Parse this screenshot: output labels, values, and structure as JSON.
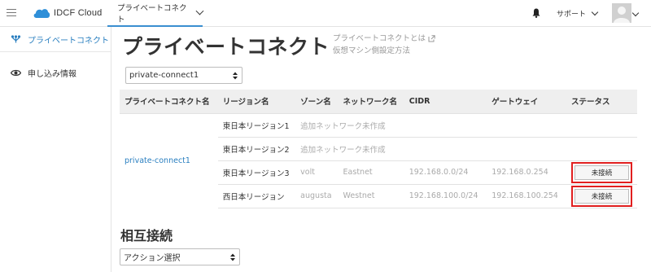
{
  "topbar": {
    "brand": "IDCF Cloud",
    "product": "プライベートコネクト",
    "support": "サポート"
  },
  "sidebar": {
    "items": [
      {
        "label": "プライベートコネクト",
        "active": true,
        "icon": "network-icon"
      },
      {
        "label": "申し込み情報",
        "active": false,
        "icon": "eye-icon"
      }
    ]
  },
  "main": {
    "title": "プライベートコネクト",
    "help_links": [
      "プライベートコネクトとは",
      "仮想マシン側設定方法"
    ],
    "connect_select": "private-connect1",
    "table": {
      "headers": [
        "プライベートコネクト名",
        "リージョン名",
        "ゾーン名",
        "ネットワーク名",
        "CIDR",
        "ゲートウェイ",
        "ステータス"
      ],
      "pc_name": "private-connect1",
      "rows": [
        {
          "region": "東日本リージョン1",
          "zone": "",
          "network": "追加ネットワーク未作成",
          "cidr": "",
          "gateway": "",
          "status": ""
        },
        {
          "region": "東日本リージョン2",
          "zone": "",
          "network": "追加ネットワーク未作成",
          "cidr": "",
          "gateway": "",
          "status": ""
        },
        {
          "region": "東日本リージョン3",
          "zone": "volt",
          "network": "Eastnet",
          "cidr": "192.168.0.0/24",
          "gateway": "192.168.0.254",
          "status": "未接続"
        },
        {
          "region": "西日本リージョン",
          "zone": "augusta",
          "network": "Westnet",
          "cidr": "192.168.100.0/24",
          "gateway": "192.168.100.254",
          "status": "未接続"
        }
      ]
    },
    "interconnect": {
      "title": "相互接続",
      "action_select": "アクション選択"
    }
  },
  "colors": {
    "accent": "#2a7fc0",
    "highlight": "#e11f1f",
    "header_bg": "#efefef"
  }
}
